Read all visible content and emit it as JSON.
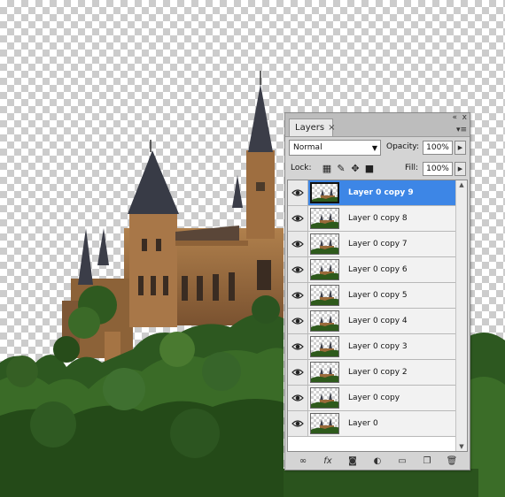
{
  "panel": {
    "tab_label": "Layers",
    "close_glyph": "×",
    "collapse_glyph": "«",
    "close_window_glyph": "x",
    "menu_glyph": "▾≡"
  },
  "blend_mode": {
    "value": "Normal"
  },
  "opacity": {
    "label": "Opacity:",
    "value": "100%"
  },
  "lock": {
    "label": "Lock:"
  },
  "fill": {
    "label": "Fill:",
    "value": "100%"
  },
  "layers": [
    {
      "name": "Layer 0 copy 9",
      "visible": true,
      "selected": true
    },
    {
      "name": "Layer 0 copy 8",
      "visible": true,
      "selected": false
    },
    {
      "name": "Layer 0 copy 7",
      "visible": true,
      "selected": false
    },
    {
      "name": "Layer 0 copy 6",
      "visible": true,
      "selected": false
    },
    {
      "name": "Layer 0 copy 5",
      "visible": true,
      "selected": false
    },
    {
      "name": "Layer 0 copy 4",
      "visible": true,
      "selected": false
    },
    {
      "name": "Layer 0 copy 3",
      "visible": true,
      "selected": false
    },
    {
      "name": "Layer 0 copy 2",
      "visible": true,
      "selected": false
    },
    {
      "name": "Layer 0 copy",
      "visible": true,
      "selected": false
    },
    {
      "name": "Layer 0",
      "visible": true,
      "selected": false
    }
  ],
  "bottom_icons": [
    "link-layers-icon",
    "fx-icon",
    "layer-mask-icon",
    "adjustment-layer-icon",
    "new-group-icon",
    "new-layer-icon",
    "trash-icon"
  ],
  "colors": {
    "selected": "#3d86e6",
    "panel": "#d4d4d4",
    "foliage": "#2e5a1c",
    "brick": "#9a6a3a"
  }
}
